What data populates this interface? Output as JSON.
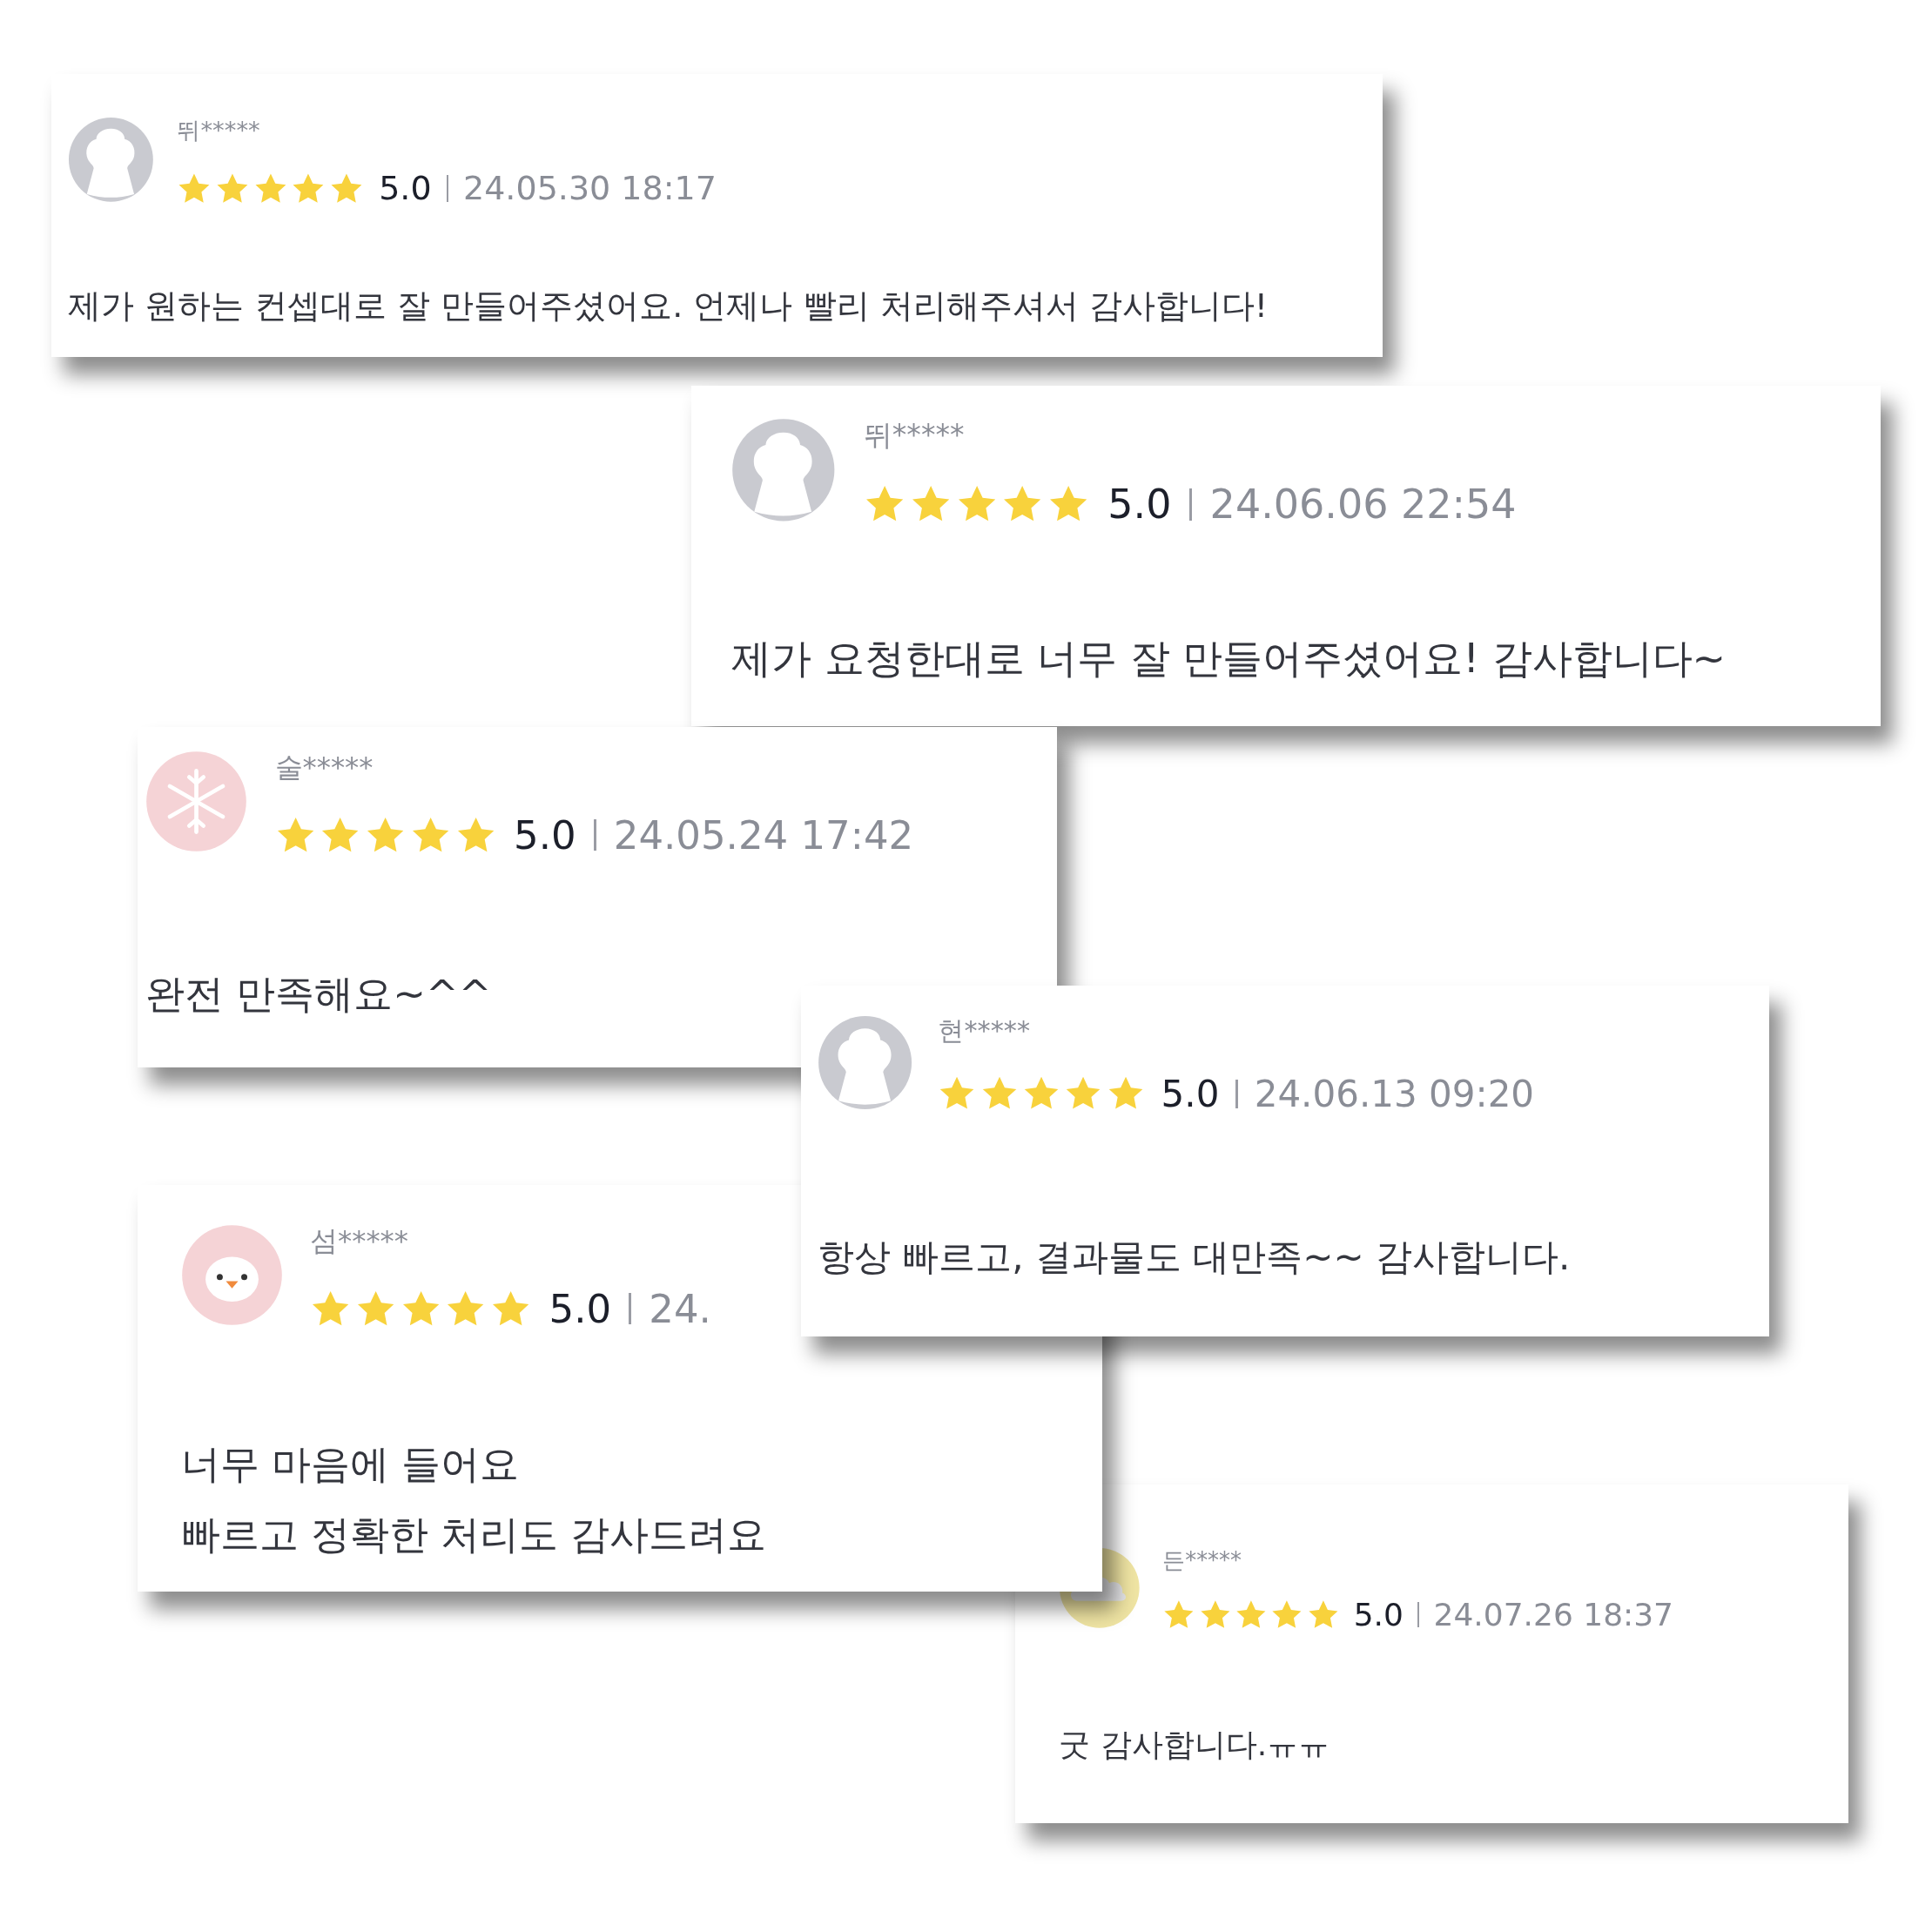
{
  "reviews": [
    {
      "author": "뛰*****",
      "avatar": {
        "kind": "default"
      },
      "stars": 5,
      "rating": "5.0",
      "date": "24.05.30 18:17",
      "text": [
        "제가 원하는 컨셉대로 잘 만들어주셨어요. 언제나 빨리 처리해주셔서 감사합니다!"
      ]
    },
    {
      "author": "뛰*****",
      "avatar": {
        "kind": "default"
      },
      "stars": 5,
      "rating": "5.0",
      "date": "24.06.06 22:54",
      "text": [
        "제가 요청한대로 너무 잘 만들어주셨어요! 감사합니다~"
      ]
    },
    {
      "author": "술*****",
      "avatar": {
        "kind": "snowflake"
      },
      "stars": 5,
      "rating": "5.0",
      "date": "24.05.24 17:42",
      "text": [
        "완전 만족해요~^^"
      ]
    },
    {
      "author": "현*****",
      "avatar": {
        "kind": "default"
      },
      "stars": 5,
      "rating": "5.0",
      "date": "24.06.13 09:20",
      "text": [
        "항상 빠르고, 결과물도 대만족~~ 감사합니다."
      ]
    },
    {
      "author": "섬*****",
      "avatar": {
        "kind": "chick"
      },
      "stars": 5,
      "rating": "5.0",
      "date": "24.",
      "text": [
        "너무 마음에 들어요",
        "빠르고 정확한 처리도 감사드려요"
      ]
    },
    {
      "author": "든*****",
      "avatar": {
        "kind": "cloud"
      },
      "stars": 5,
      "rating": "5.0",
      "date": "24.07.26 18:37",
      "text": [
        "굿 감사합니다.ㅠㅠ"
      ]
    }
  ]
}
